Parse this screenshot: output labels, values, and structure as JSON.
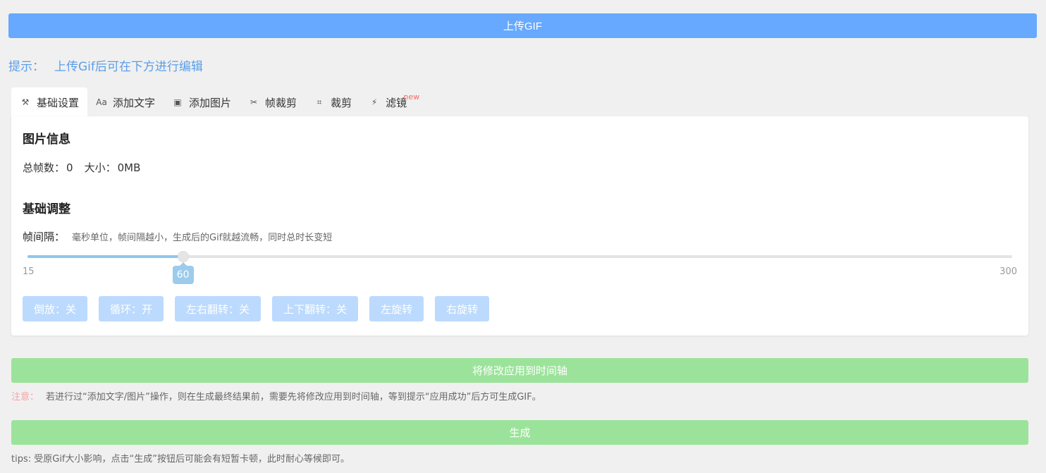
{
  "upload": {
    "label": "上传GIF"
  },
  "hint": {
    "prefix": "提示：",
    "text": "上传Gif后可在下方进行编辑"
  },
  "tabs": [
    {
      "label": "基础设置",
      "icon": "hammer-icon",
      "glyph": "⚒"
    },
    {
      "label": "添加文字",
      "icon": "text-icon",
      "glyph": "Aa"
    },
    {
      "label": "添加图片",
      "icon": "image-icon",
      "glyph": "▣"
    },
    {
      "label": "帧裁剪",
      "icon": "scissors-icon",
      "glyph": "✂"
    },
    {
      "label": "裁剪",
      "icon": "crop-icon",
      "glyph": "⌗"
    },
    {
      "label": "滤镜",
      "icon": "magic-wand-icon",
      "glyph": "⚡",
      "badge": "new"
    }
  ],
  "info": {
    "title": "图片信息",
    "frames_label": "总帧数：",
    "frames_value": "0",
    "size_label": "大小：",
    "size_value": "0MB"
  },
  "adjust": {
    "title": "基础调整",
    "interval_label": "帧间隔：",
    "interval_desc": "毫秒单位，帧间隔越小，生成后的Gif就越流畅，同时总时长变短",
    "slider": {
      "min": 15,
      "max": 300,
      "value": 60,
      "min_label": "15",
      "max_label": "300",
      "value_label": "60"
    }
  },
  "options": [
    {
      "label": "倒放：关",
      "name": "reverse-button"
    },
    {
      "label": "循环：开",
      "name": "loop-button"
    },
    {
      "label": "左右翻转：关",
      "name": "flip-horizontal-button"
    },
    {
      "label": "上下翻转：关",
      "name": "flip-vertical-button"
    },
    {
      "label": "左旋转",
      "name": "rotate-left-button"
    },
    {
      "label": "右旋转",
      "name": "rotate-right-button"
    }
  ],
  "apply": {
    "label": "将修改应用到时间轴"
  },
  "note": {
    "warn": "注意：",
    "text": "若进行过“添加文字/图片”操作，则在生成最终结果前，需要先将修改应用到时间轴，等到提示“应用成功”后方可生成GIF。"
  },
  "generate": {
    "label": "生成"
  },
  "tips": {
    "text": "tips: 受原Gif大小影响，点击“生成”按钮后可能会有短暂卡顿，此时耐心等候即可。"
  },
  "colors": {
    "primary": "#66a9ff",
    "success": "#9be39a",
    "slider_fill": "#8fc7ee",
    "warn": "#f5a3a3"
  }
}
